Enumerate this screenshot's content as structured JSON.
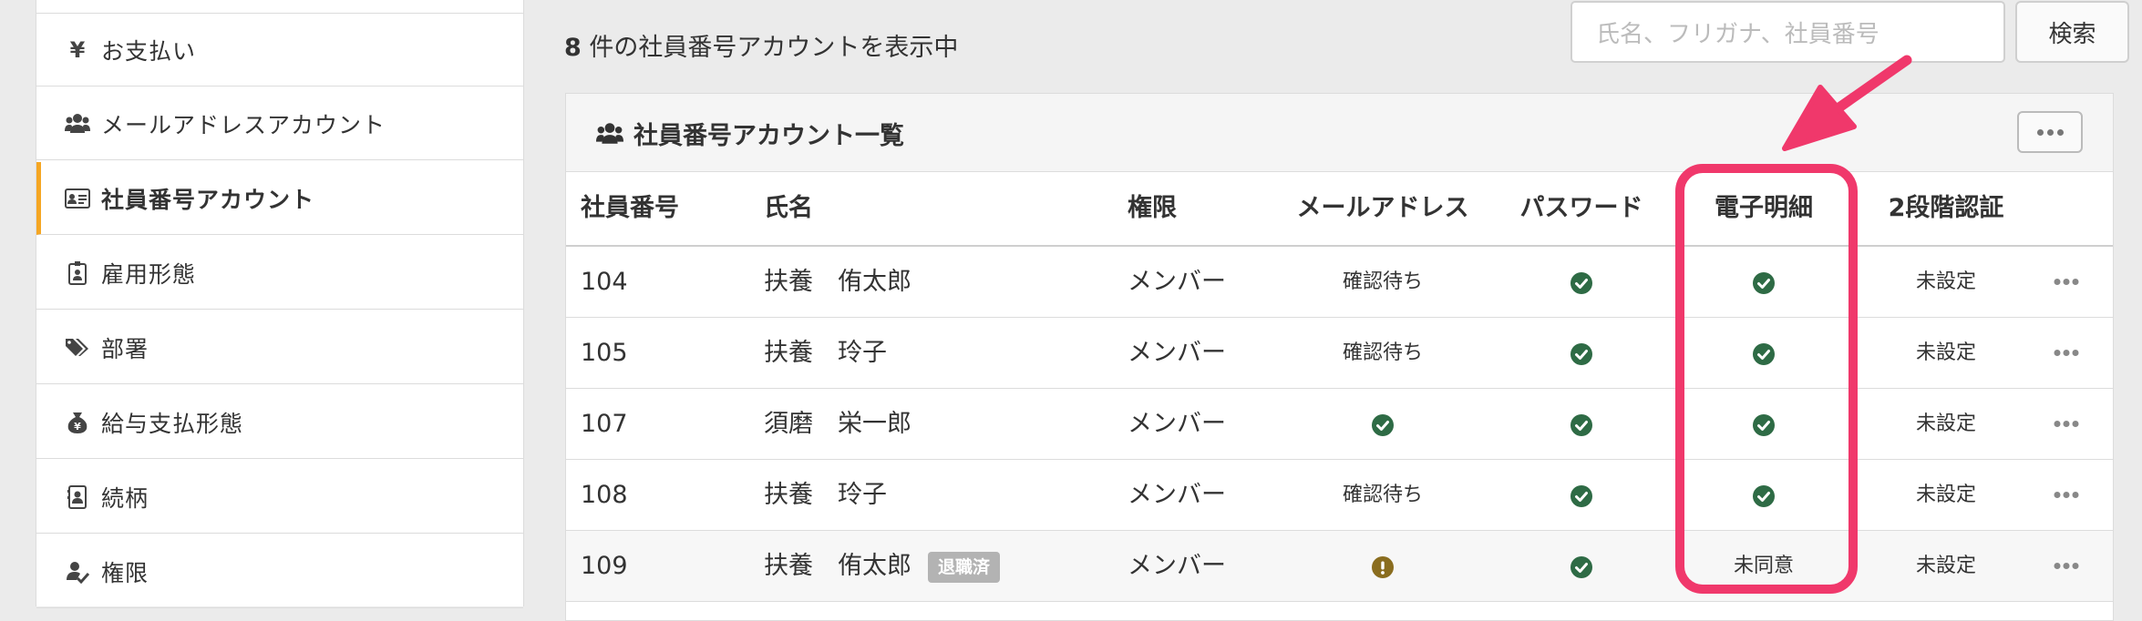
{
  "sidebar": {
    "items": [
      {
        "label": "お支払い",
        "icon": "yen-icon",
        "active": false
      },
      {
        "label": "メールアドレスアカウント",
        "icon": "users-icon",
        "active": false
      },
      {
        "label": "社員番号アカウント",
        "icon": "id-card-icon",
        "active": true
      },
      {
        "label": "雇用形態",
        "icon": "badge-icon",
        "active": false
      },
      {
        "label": "部署",
        "icon": "tags-icon",
        "active": false
      },
      {
        "label": "給与支払形態",
        "icon": "money-bag-icon",
        "active": false
      },
      {
        "label": "続柄",
        "icon": "contact-icon",
        "active": false
      },
      {
        "label": "権限",
        "icon": "user-check-icon",
        "active": false
      }
    ]
  },
  "top": {
    "count": "8",
    "count_suffix": " 件の社員番号アカウントを表示中",
    "search_placeholder": "氏名、フリガナ、社員番号",
    "search_button": "検索"
  },
  "panel": {
    "title": "社員番号アカウント一覧",
    "columns": [
      "社員番号",
      "氏名",
      "権限",
      "メールアドレス",
      "パスワード",
      "電子明細",
      "2段階認証"
    ],
    "rows": [
      {
        "id": "104",
        "name": "扶養　侑太郎",
        "retired": "",
        "role": "メンバー",
        "email": "確認待ち",
        "email_state": "text",
        "password": "ok",
        "payslip": "ok",
        "payslip_text": "",
        "twofa": "未設定"
      },
      {
        "id": "105",
        "name": "扶養　玲子",
        "retired": "",
        "role": "メンバー",
        "email": "確認待ち",
        "email_state": "text",
        "password": "ok",
        "payslip": "ok",
        "payslip_text": "",
        "twofa": "未設定"
      },
      {
        "id": "107",
        "name": "須磨　栄一郎",
        "retired": "",
        "role": "メンバー",
        "email": "",
        "email_state": "ok",
        "password": "ok",
        "payslip": "ok",
        "payslip_text": "",
        "twofa": "未設定"
      },
      {
        "id": "108",
        "name": "扶養　玲子",
        "retired": "",
        "role": "メンバー",
        "email": "確認待ち",
        "email_state": "text",
        "password": "ok",
        "payslip": "ok",
        "payslip_text": "",
        "twofa": "未設定"
      },
      {
        "id": "109",
        "name": "扶養　侑太郎",
        "retired": "退職済",
        "role": "メンバー",
        "email": "",
        "email_state": "warn",
        "password": "ok",
        "payslip": "text",
        "payslip_text": "未同意",
        "twofa": "未設定"
      }
    ]
  },
  "colors": {
    "accent": "#f5a623",
    "check": "#2e6b45",
    "warn": "#8a6d1f",
    "highlight": "#f0386b",
    "badge": "#b3b3b3"
  }
}
